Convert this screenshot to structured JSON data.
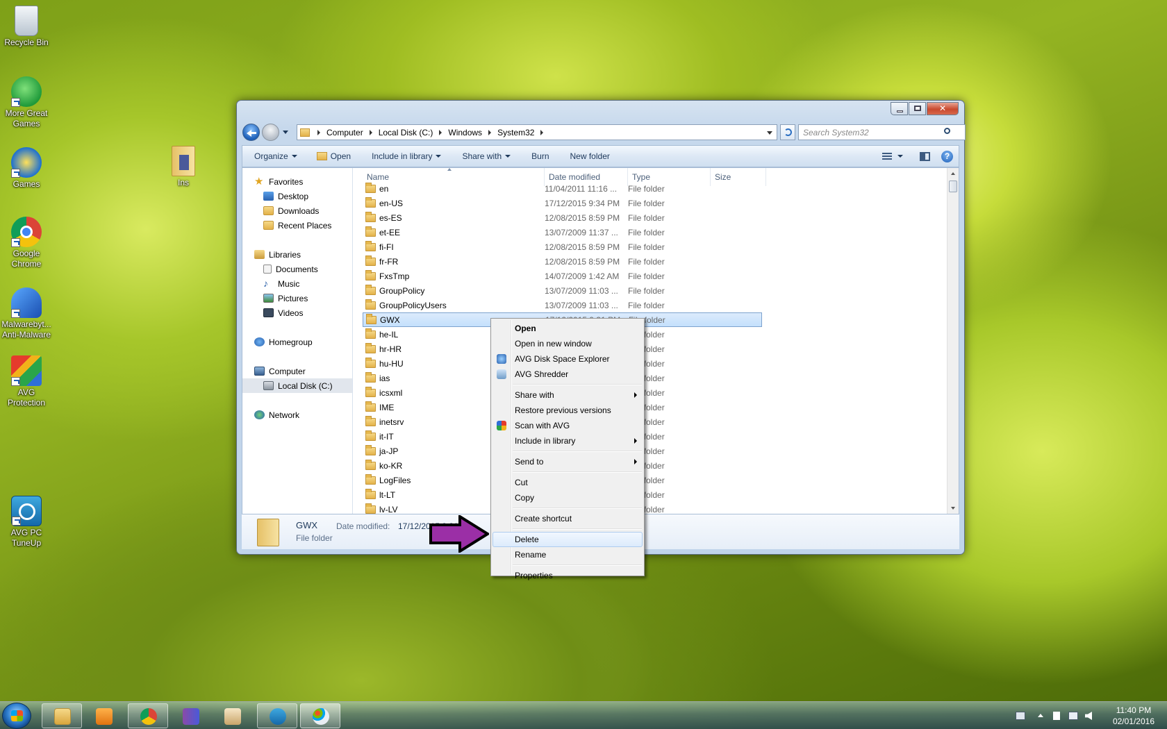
{
  "desktop": {
    "icons": [
      {
        "label": "Recycle Bin"
      },
      {
        "label": "More Great Games"
      },
      {
        "label": "Games"
      },
      {
        "label": "Google Chrome"
      },
      {
        "label": "Malwarebytes Anti-Malware",
        "line1": "Malwarebyt...",
        "line2": "Anti-Malware"
      },
      {
        "label": "AVG Protection"
      },
      {
        "label": "AVG PC TuneUp"
      },
      {
        "label": "Ins"
      }
    ]
  },
  "explorer": {
    "address": {
      "crumbs": [
        "Computer",
        "Local Disk (C:)",
        "Windows",
        "System32"
      ]
    },
    "search_placeholder": "Search System32",
    "toolbar": {
      "organize": "Organize",
      "open": "Open",
      "include_in_library": "Include in library",
      "share_with": "Share with",
      "burn": "Burn",
      "new_folder": "New folder"
    },
    "nav": {
      "favorites": "Favorites",
      "desktop": "Desktop",
      "downloads": "Downloads",
      "recent_places": "Recent Places",
      "libraries": "Libraries",
      "documents": "Documents",
      "music": "Music",
      "pictures": "Pictures",
      "videos": "Videos",
      "homegroup": "Homegroup",
      "computer": "Computer",
      "local_disk": "Local Disk (C:)",
      "network": "Network"
    },
    "columns": {
      "name": "Name",
      "date_modified": "Date modified",
      "type": "Type",
      "size": "Size"
    },
    "rows": [
      {
        "name": "en",
        "date": "11/04/2011 11:16 ...",
        "type": "File folder"
      },
      {
        "name": "en-US",
        "date": "17/12/2015 9:34 PM",
        "type": "File folder"
      },
      {
        "name": "es-ES",
        "date": "12/08/2015 8:59 PM",
        "type": "File folder"
      },
      {
        "name": "et-EE",
        "date": "13/07/2009 11:37 ...",
        "type": "File folder"
      },
      {
        "name": "fi-FI",
        "date": "12/08/2015 8:59 PM",
        "type": "File folder"
      },
      {
        "name": "fr-FR",
        "date": "12/08/2015 8:59 PM",
        "type": "File folder"
      },
      {
        "name": "FxsTmp",
        "date": "14/07/2009 1:42 AM",
        "type": "File folder"
      },
      {
        "name": "GroupPolicy",
        "date": "13/07/2009 11:03 ...",
        "type": "File folder"
      },
      {
        "name": "GroupPolicyUsers",
        "date": "13/07/2009 11:03 ...",
        "type": "File folder"
      },
      {
        "name": "GWX",
        "date": "17/12/2015 9:31 PM",
        "type": "File folder",
        "selected": true
      },
      {
        "name": "he-IL",
        "date": "",
        "type": "File folder"
      },
      {
        "name": "hr-HR",
        "date": "",
        "type": "File folder"
      },
      {
        "name": "hu-HU",
        "date": "",
        "type": "File folder"
      },
      {
        "name": "ias",
        "date": "",
        "type": "File folder"
      },
      {
        "name": "icsxml",
        "date": "",
        "type": "File folder"
      },
      {
        "name": "IME",
        "date": "",
        "type": "File folder"
      },
      {
        "name": "inetsrv",
        "date": "",
        "type": "File folder"
      },
      {
        "name": "it-IT",
        "date": "",
        "type": "File folder"
      },
      {
        "name": "ja-JP",
        "date": "",
        "type": "File folder"
      },
      {
        "name": "ko-KR",
        "date": "",
        "type": "File folder"
      },
      {
        "name": "LogFiles",
        "date": "",
        "type": "File folder"
      },
      {
        "name": "lt-LT",
        "date": "",
        "type": "File folder"
      },
      {
        "name": "lv-LV",
        "date": "",
        "type": "File folder"
      }
    ],
    "details": {
      "name": "GWX",
      "kind": "File folder",
      "date_label": "Date modified:",
      "date_value": "17/12/2015 9:31 PM"
    }
  },
  "context_menu": {
    "items": [
      {
        "label": "Open",
        "bold": true
      },
      {
        "label": "Open in new window"
      },
      {
        "label": "AVG Disk Space Explorer",
        "icon": "avg-disk-icon"
      },
      {
        "label": "AVG Shredder",
        "icon": "avg-shredder-icon"
      },
      {
        "label": "Share with",
        "submenu": true
      },
      {
        "label": "Restore previous versions"
      },
      {
        "label": "Scan with AVG",
        "icon": "avg-scan-icon"
      },
      {
        "label": "Include in library",
        "submenu": true
      },
      {
        "label": "Send to",
        "submenu": true
      },
      {
        "label": "Cut"
      },
      {
        "label": "Copy"
      },
      {
        "label": "Create shortcut"
      },
      {
        "label": "Delete",
        "highlighted": true
      },
      {
        "label": "Rename"
      },
      {
        "label": "Properties"
      }
    ]
  },
  "taskbar": {
    "apps": [
      "explorer-icon",
      "media-player-icon",
      "chrome-icon",
      "winrar-icon",
      "avg-icon",
      "tuneup-icon",
      "paint-icon"
    ],
    "time": "11:40 PM",
    "date": "02/01/2016"
  },
  "colors": {
    "annotation_arrow": "#9b2fa6",
    "selection": "#c4e0fc",
    "toolbar_text": "#1e395b"
  }
}
